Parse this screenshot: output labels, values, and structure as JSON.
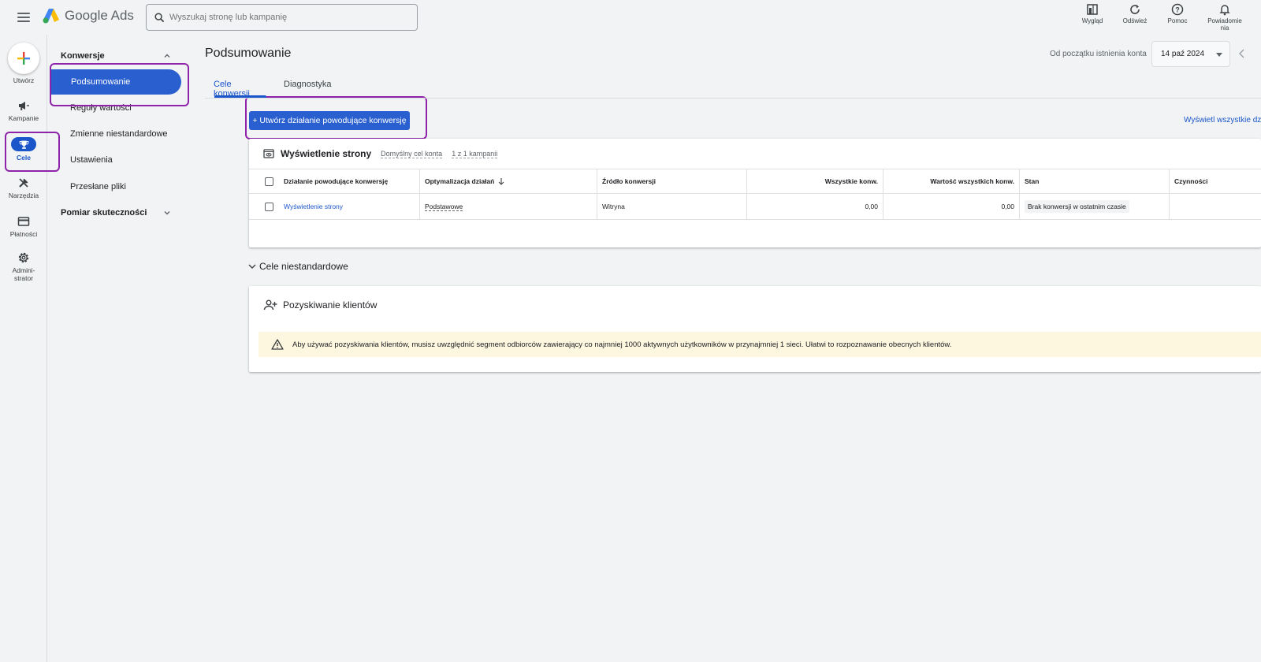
{
  "app": {
    "name": "Google Ads"
  },
  "search": {
    "placeholder": "Wyszukaj stronę lub kampanię"
  },
  "top_actions": [
    {
      "label": "Wygląd",
      "icon": "appearance-icon"
    },
    {
      "label": "Odśwież",
      "icon": "refresh-icon"
    },
    {
      "label": "Pomoc",
      "icon": "help-icon"
    },
    {
      "label": "Powiadomie nia",
      "icon": "bell-icon"
    }
  ],
  "rail": {
    "create": "Utwórz",
    "campaigns": "Kampanie",
    "goals": "Cele",
    "tools": "Narzędzia",
    "billing": "Płatności",
    "admin_line1": "Admini-",
    "admin_line2": "strator",
    "active": "goals"
  },
  "section_nav": {
    "group1": "Konwersje",
    "active_item": "Podsumowanie",
    "items": [
      "Reguły wartości",
      "Zmienne niestandardowe",
      "Ustawienia",
      "Przesłane pliki"
    ],
    "group2": "Pomiar skuteczności"
  },
  "page": {
    "title": "Podsumowanie",
    "date_range_label": "Od początku istnienia konta",
    "date_value": "14 paź 2024"
  },
  "tabs": [
    {
      "label": "Cele konwersji",
      "active": true
    },
    {
      "label": "Diagnostyka",
      "active": false
    }
  ],
  "actions": {
    "create_conversion": "+ Utwórz działanie powodujące konwersję",
    "view_all": "Wyświetl wszystkie dział"
  },
  "goal_card": {
    "title": "Wyświetlenie strony",
    "default_goal": "Domyślny cel konta",
    "campaigns": "1 z 1 kampanii",
    "columns": [
      "Działanie powodujące konwersję",
      "Optymalizacja działań",
      "Źródło konwersji",
      "Wszystkie konw.",
      "Wartość wszystkich konw.",
      "Stan",
      "Czynności"
    ],
    "rows": [
      {
        "action": "Wyświetlenie strony",
        "optimization": "Podstawowe",
        "source": "Witryna",
        "all_conv": "0,00",
        "all_conv_value": "0,00",
        "status": "Brak konwersji w ostatnim czasie",
        "actions": ""
      }
    ]
  },
  "custom_goals": {
    "label": "Cele niestandardowe"
  },
  "acquisition_card": {
    "title": "Pozyskiwanie klientów",
    "warning": "Aby używać pozyskiwania klientów, musisz uwzględnić segment odbiorców zawierający co najmniej 1000 aktywnych użytkowników w przynajmniej 1 sieci. Ułatwi to rozpoznawanie obecnych klientów."
  },
  "colors": {
    "accent": "#1a56c9",
    "highlight": "#8e24aa",
    "warning_bg": "#fef7e0"
  }
}
